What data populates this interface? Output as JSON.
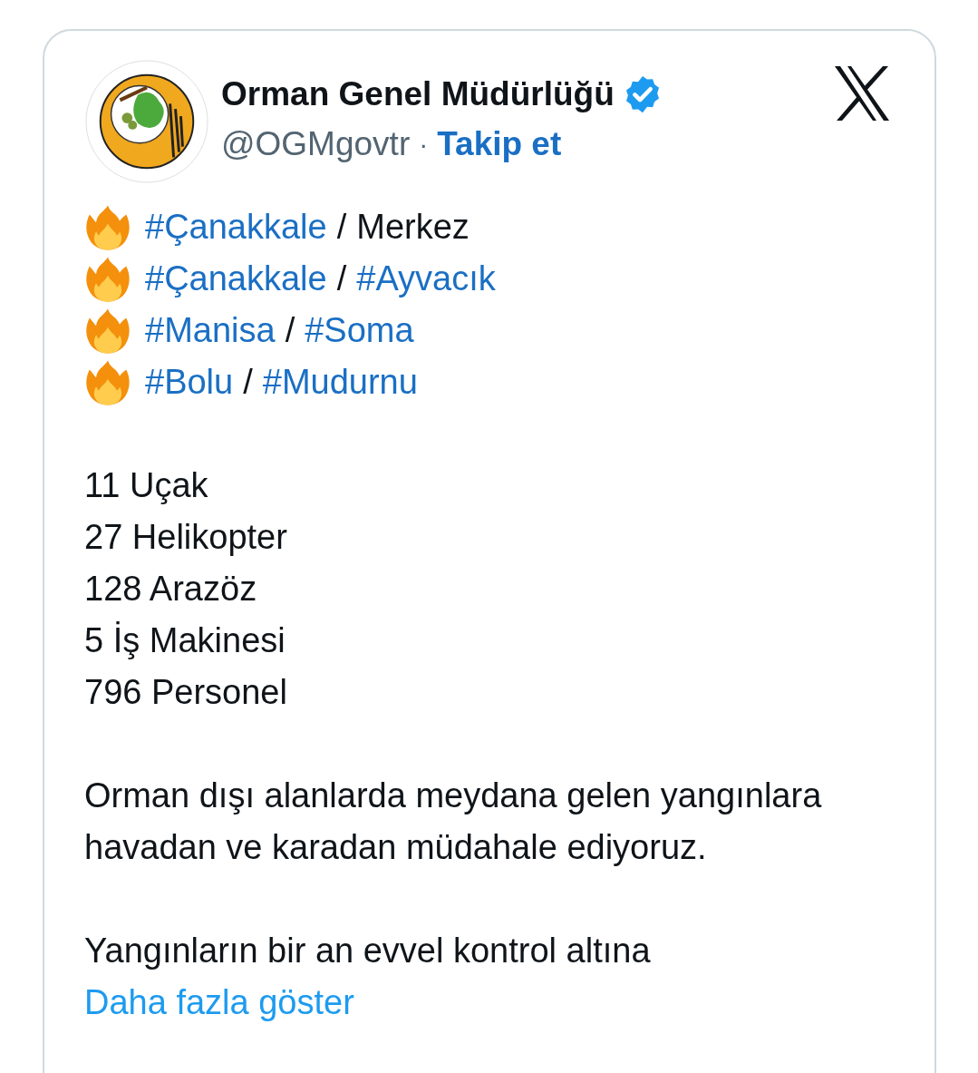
{
  "account": {
    "name": "Orman Genel Müdürlüğü",
    "verified": true,
    "handle": "@OGMgovtr",
    "separator": "·",
    "follow": "Takip et"
  },
  "locations": [
    {
      "parts": [
        {
          "text": "#Çanakkale",
          "kind": "hashtag"
        },
        {
          "text": "/",
          "kind": "plain"
        },
        {
          "text": "Merkez",
          "kind": "plain"
        }
      ]
    },
    {
      "parts": [
        {
          "text": "#Çanakkale",
          "kind": "hashtag"
        },
        {
          "text": "/",
          "kind": "plain"
        },
        {
          "text": "#Ayvacık",
          "kind": "hashtag"
        }
      ]
    },
    {
      "parts": [
        {
          "text": "#Manisa",
          "kind": "hashtag"
        },
        {
          "text": "/",
          "kind": "plain"
        },
        {
          "text": "#Soma",
          "kind": "hashtag"
        }
      ]
    },
    {
      "parts": [
        {
          "text": "#Bolu",
          "kind": "hashtag"
        },
        {
          "text": "/",
          "kind": "plain"
        },
        {
          "text": "#Mudurnu",
          "kind": "hashtag"
        }
      ]
    }
  ],
  "stats": [
    "11 Uçak",
    "27 Helikopter",
    "128 Arazöz",
    "5 İş Makinesi",
    "796 Personel"
  ],
  "paragraph": "Orman dışı alanlarda meydana gelen yangınlara havadan ve karadan müdahale ediyoruz.",
  "last_paragraph": {
    "text": "Yangınların bir an evvel kontrol altına",
    "more_link": "Daha fazla göster"
  }
}
